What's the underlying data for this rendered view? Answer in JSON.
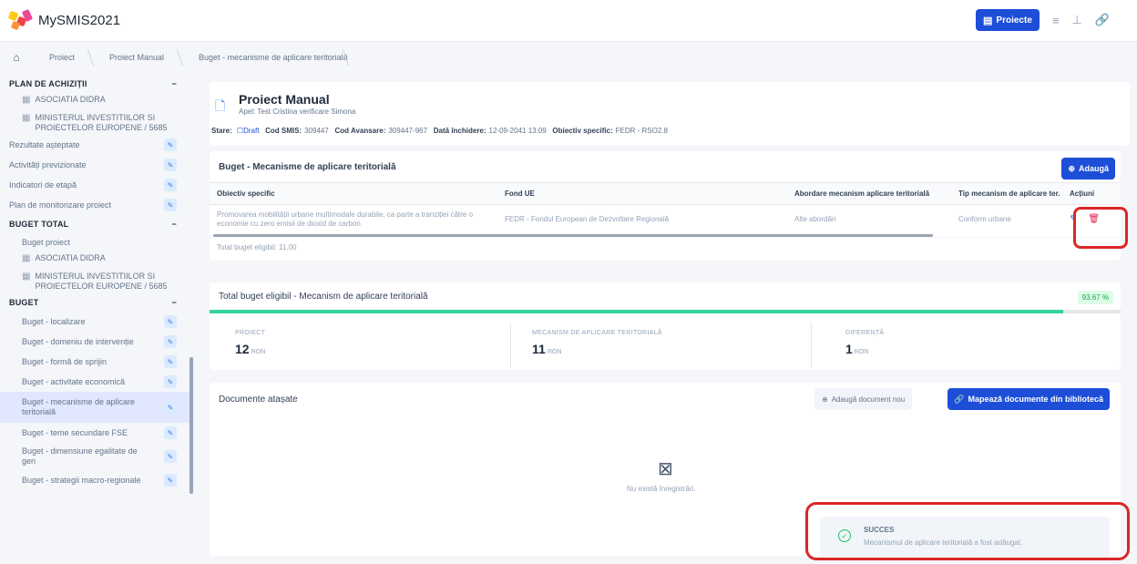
{
  "app": {
    "title": "MySMIS2021",
    "project_button": "Proiecte",
    "colors": {
      "accent": "#1d4ed8",
      "highlight": "#dc2626",
      "success": "#22c55e",
      "danger": "#e11d48"
    }
  },
  "breadcrumb": [
    "Proiect",
    "Proiect Manual",
    "Buget - mecanisme de aplicare teritorială"
  ],
  "sidebar": {
    "sections": [
      {
        "title": "PLAN DE ACHIZIȚII",
        "subs": [
          "ASOCIATIA DIDRA",
          "MINISTERUL INVESTITIILOR SI PROIECTELOR EUROPENE / 5685"
        ]
      },
      {
        "items": [
          "Rezultate așteptate",
          "Activități previzionate",
          "Indicatori de etapă",
          "Plan de monitorizare proiect"
        ]
      },
      {
        "title": "BUGET TOTAL",
        "plain": "Buget proiect",
        "subs": [
          "ASOCIATIA DIDRA",
          "MINISTERUL INVESTITIILOR SI PROIECTELOR EUROPENE / 5685"
        ]
      },
      {
        "title": "BUGET",
        "items": [
          "Buget - localizare",
          "Buget - domeniu de intervenție",
          "Buget - formă de sprijin",
          "Buget - activitate economică",
          "Buget - mecanisme de aplicare teritorială",
          "Buget - teme secundare FSE",
          "Buget - dimensiune egalitate de gen",
          "Buget - strategii macro-regionale"
        ]
      }
    ]
  },
  "project": {
    "title": "Proiect Manual",
    "applicant": "Apel: Test Cristina verificare Simona",
    "stare_label": "Stare:",
    "stare_value": "Draft",
    "cod_smis_label": "Cod SMIS:",
    "cod_smis": "309447",
    "cod_avansare_label": "Cod Avansare:",
    "cod_avansare": "309447-967",
    "data_inchidere_label": "Dată închidere:",
    "data_inchidere": "12-09-2041 13:09",
    "obiectiv_label": "Obiectiv specific:",
    "obiectiv": "FEDR - RSO2.8"
  },
  "budget_card": {
    "title": "Buget - Mecanisme de aplicare teritorială",
    "add_button": "Adaugă",
    "columns": [
      "Obiectiv specific",
      "Fond UE",
      "Abordare mecanism aplicare teritorială",
      "Tip mecanism de aplicare ter.",
      "Acțiuni"
    ],
    "rows": [
      {
        "obiectiv": "Promovarea mobilității urbane multimodale durabile, ca parte a tranziției către o economie cu zero emisii de dioxid de carbon",
        "fond": "FEDR - Fondul European de Dezvoltare Regională",
        "abordare": "Alte abordări",
        "tip": "Conform urbane"
      }
    ],
    "total_note": "Total buget eligibil: 11.00"
  },
  "total_card": {
    "title": "Total buget eligibil - Mecanism de aplicare teritorială",
    "percent": 93.67,
    "percent_label": "93.67 %",
    "stats": [
      {
        "label": "PROIECT",
        "value": "12",
        "unit": "RON"
      },
      {
        "label": "MECANISM DE APLICARE TERITORIALĂ",
        "value": "11",
        "unit": "RON"
      },
      {
        "label": "DIFERENȚĂ",
        "value": "1",
        "unit": "RON"
      }
    ]
  },
  "docs_card": {
    "title": "Documente atașate",
    "add_new": "Adaugă document nou",
    "import_button": "Mapează documente din bibliotecă",
    "empty": "Nu există înregistrări."
  },
  "toast": {
    "title": "SUCCES",
    "message": "Mecanismul de aplicare teritorială a fost adăugat."
  }
}
